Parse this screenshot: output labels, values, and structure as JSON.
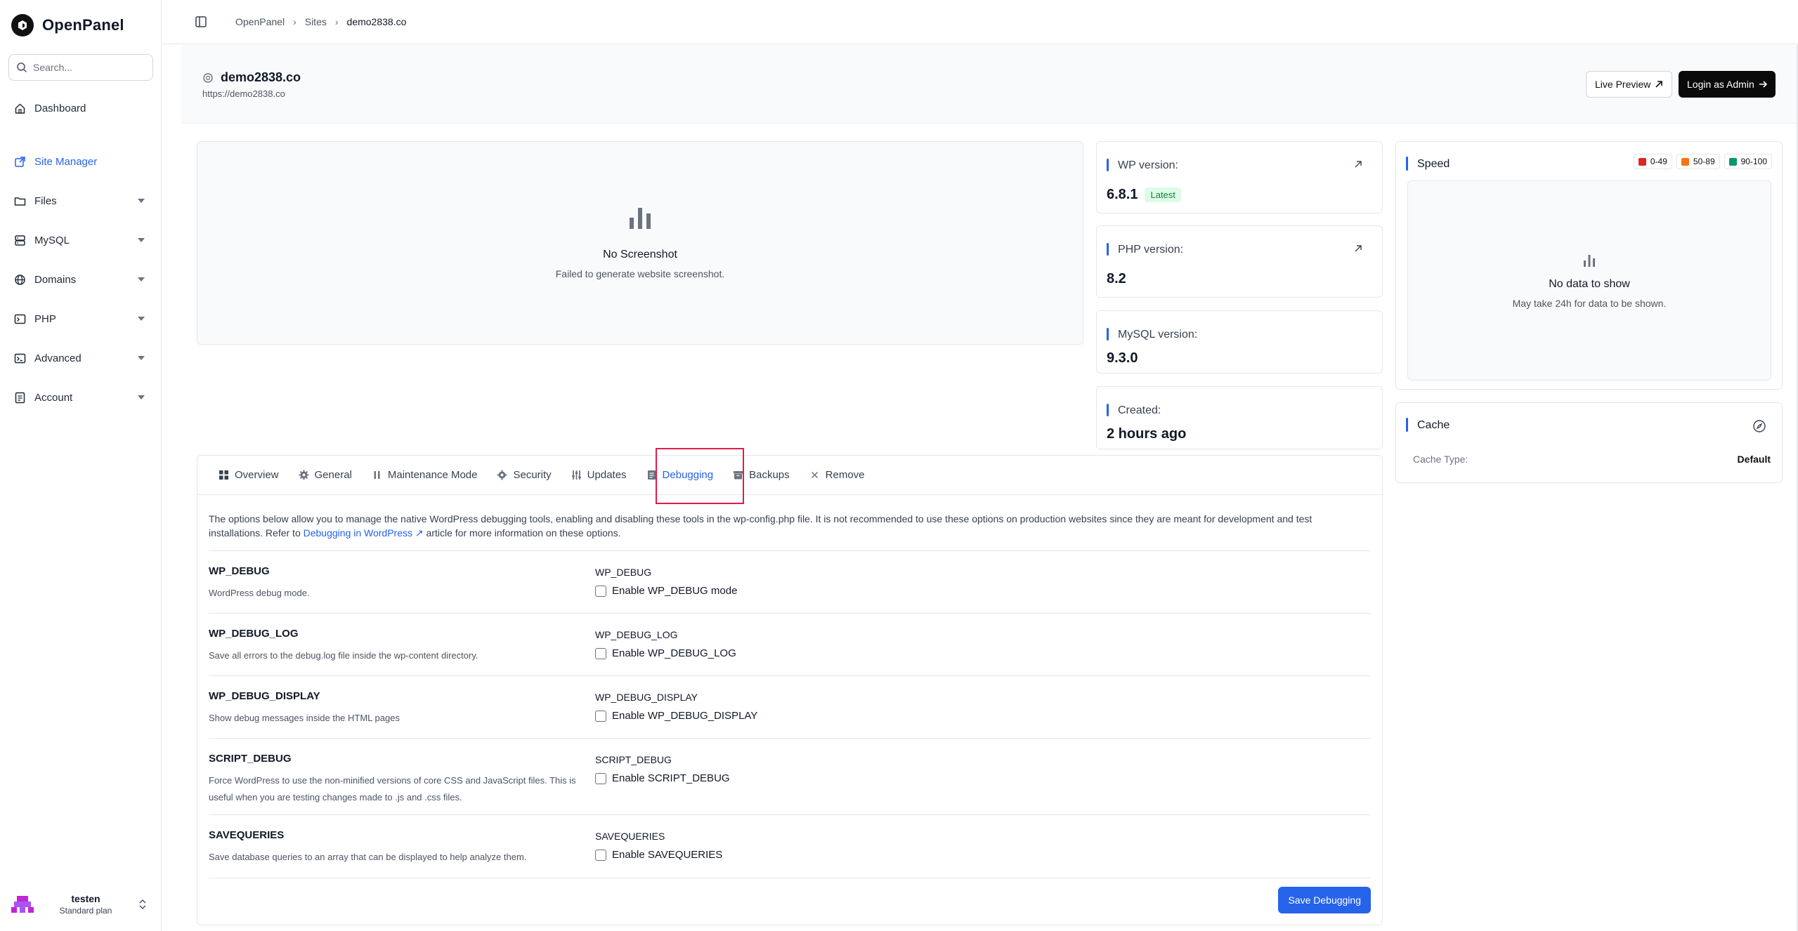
{
  "sidebar": {
    "brand": "OpenPanel",
    "search_placeholder": "Search...",
    "items": [
      {
        "label": "Dashboard"
      },
      {
        "label": "Site Manager"
      },
      {
        "label": "Files"
      },
      {
        "label": "MySQL"
      },
      {
        "label": "Domains"
      },
      {
        "label": "PHP"
      },
      {
        "label": "Advanced"
      },
      {
        "label": "Account"
      }
    ],
    "user": {
      "name": "testen",
      "plan": "Standard plan"
    }
  },
  "breadcrumb": [
    "OpenPanel",
    "Sites",
    "demo2838.co"
  ],
  "site": {
    "title": "demo2838.co",
    "url": "https://demo2838.co",
    "live_preview": "Live Preview",
    "login_admin": "Login as Admin"
  },
  "screenshot": {
    "title": "No Screenshot",
    "sub": "Failed to generate website screenshot."
  },
  "stats": {
    "wp": {
      "label": "WP version:",
      "value": "6.8.1",
      "badge": "Latest"
    },
    "php": {
      "label": "PHP version:",
      "value": "8.2"
    },
    "mysql": {
      "label": "MySQL version:",
      "value": "9.3.0"
    },
    "created": {
      "label": "Created:",
      "value": "2 hours ago"
    }
  },
  "speed": {
    "title": "Speed",
    "legend": [
      {
        "label": "0-49",
        "color": "#dc2626"
      },
      {
        "label": "50-89",
        "color": "#f97316"
      },
      {
        "label": "90-100",
        "color": "#059669"
      }
    ],
    "empty_title": "No data to show",
    "empty_sub": "May take 24h for data to be shown."
  },
  "cache": {
    "title": "Cache",
    "type_label": "Cache Type:",
    "type_value": "Default"
  },
  "tabs": [
    "Overview",
    "General",
    "Maintenance Mode",
    "Security",
    "Updates",
    "Debugging",
    "Backups",
    "Remove"
  ],
  "debugging": {
    "intro_1": "The options below allow you to manage the native WordPress debugging tools, enabling and disabling these tools in the wp-config.php file. It is not recommended to use these options on production websites since they are meant for development and test installations. Refer to ",
    "intro_link": "Debugging in WordPress",
    "intro_2": " article for more information on these options.",
    "options": [
      {
        "name": "WP_DEBUG",
        "desc": "WordPress debug mode.",
        "field": "WP_DEBUG",
        "check": "Enable WP_DEBUG mode"
      },
      {
        "name": "WP_DEBUG_LOG",
        "desc": "Save all errors to the debug.log file inside the wp-content directory.",
        "field": "WP_DEBUG_LOG",
        "check": "Enable WP_DEBUG_LOG"
      },
      {
        "name": "WP_DEBUG_DISPLAY",
        "desc": "Show debug messages inside the HTML pages",
        "field": "WP_DEBUG_DISPLAY",
        "check": "Enable WP_DEBUG_DISPLAY"
      },
      {
        "name": "SCRIPT_DEBUG",
        "desc": "Force WordPress to use the non-minified versions of core CSS and JavaScript files. This is useful when you are testing changes made to .js and .css files.",
        "field": "SCRIPT_DEBUG",
        "check": "Enable SCRIPT_DEBUG"
      },
      {
        "name": "SAVEQUERIES",
        "desc": "Save database queries to an array that can be displayed to help analyze them.",
        "field": "SAVEQUERIES",
        "check": "Enable SAVEQUERIES"
      }
    ],
    "save_label": "Save Debugging"
  }
}
